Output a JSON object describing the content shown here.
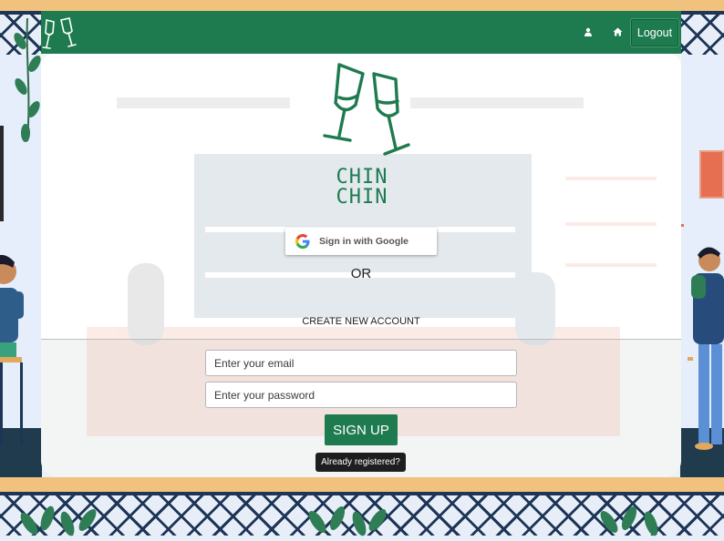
{
  "header": {
    "logo_icon": "champagne-glasses-icon",
    "user_icon": "user-icon",
    "home_icon": "home-icon",
    "logout_label": "Logout"
  },
  "brand": {
    "logo_icon": "champagne-glasses-logo",
    "name_top": "CHIN",
    "name_bottom": "CHIN"
  },
  "auth": {
    "google_icon": "google-icon",
    "google_label": "Sign in with Google",
    "or_label": "OR",
    "create_label": "CREATE NEW ACCOUNT",
    "email_placeholder": "Enter your email",
    "password_placeholder": "Enter your password",
    "signup_label": "SIGN UP",
    "tooltip_label": "Already registered?"
  },
  "colors": {
    "brand_green": "#1e7b4f",
    "band_orange": "#f1c27d",
    "lattice_navy": "#1d3557"
  }
}
